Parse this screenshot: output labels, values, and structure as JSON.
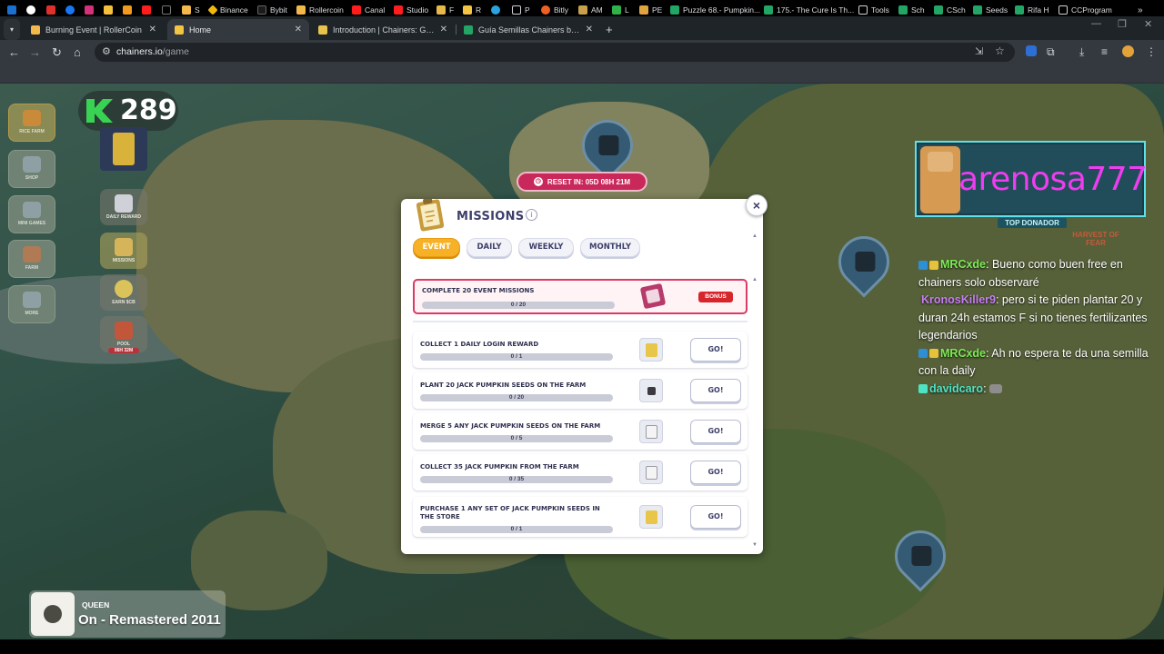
{
  "browser": {
    "tabs": [
      {
        "title": "Burning Event | RollerCoin",
        "active": false
      },
      {
        "title": "Home",
        "active": true
      },
      {
        "title": "Introduction | Chainers: GitBook",
        "active": false
      },
      {
        "title": "Guía Semillas Chainers by Pierc",
        "active": false
      }
    ],
    "new_tab": "+",
    "url_host": "chainers.io",
    "url_path": "/game",
    "bookmarks": [
      "S",
      "Binance",
      "Bybit",
      "Rollercoin",
      "Canal",
      "Studio",
      "F",
      "R",
      "P",
      "Bitly",
      "AM",
      "L",
      "PE",
      "Puzzle 68.- Pumpkin...",
      "175.- The Cure Is Th...",
      "Tools",
      "Sch",
      "CSch",
      "Seeds",
      "Rifa H",
      "CCProgram"
    ]
  },
  "game": {
    "currency_count": "289",
    "reset_timer": "RESET IN: 05D 08H 21M",
    "sidebar": [
      "SHOP",
      "MINI GAMES",
      "FARM",
      "MORE"
    ],
    "side_items": [
      "DAILY REWARD",
      "MISSIONS",
      "EARN $CB",
      "POOL"
    ],
    "side_top_label": "RICE FARM",
    "pool_timer": "06H 32M",
    "map_label": "HARVEST OF FEAR"
  },
  "missions": {
    "title": "MISSIONS",
    "info_icon": "i",
    "close_icon": "×",
    "tabs": [
      "EVENT",
      "DAILY",
      "WEEKLY",
      "MONTHLY"
    ],
    "active_tab": "EVENT",
    "bonus": {
      "label": "COMPLETE 20 EVENT MISSIONS",
      "progress_text": "0 / 20",
      "progress": 0,
      "tag": "BONUS"
    },
    "items": [
      {
        "label": "COLLECT 1 DAILY LOGIN REWARD",
        "progress_text": "0 / 1",
        "progress": 0,
        "go": "GO!"
      },
      {
        "label": "PLANT 20 JACK PUMPKIN SEEDS ON THE FARM",
        "progress_text": "0 / 20",
        "progress": 0,
        "go": "GO!"
      },
      {
        "label": "MERGE 5 ANY JACK PUMPKIN SEEDS ON THE FARM",
        "progress_text": "0 / 5",
        "progress": 0,
        "go": "GO!"
      },
      {
        "label": "COLLECT 35 JACK PUMPKIN FROM THE FARM",
        "progress_text": "0 / 35",
        "progress": 0,
        "go": "GO!"
      },
      {
        "label": "PURCHASE 1 ANY SET OF JACK PUMPKIN SEEDS IN THE STORE",
        "progress_text": "0 / 1",
        "progress": 0,
        "go": "GO!"
      }
    ]
  },
  "overlay": {
    "donor_name": "arenosa777",
    "donor_label": "TOP DONADOR",
    "chat": [
      {
        "user": "MRCxde",
        "text": ": Bueno como buen free en chainers solo observaré",
        "color": "green"
      },
      {
        "user": "KronosKiller9",
        "text": ": pero si te piden plantar 20 y duran 24h estamos F si no tienes fertilizantes legendarios",
        "color": "purple"
      },
      {
        "user": "MRCxde",
        "text": ": Ah no espera te da una semilla con la daily",
        "color": "green"
      },
      {
        "user": "davidcaro",
        "text": ":",
        "color": "teal"
      }
    ],
    "now_playing_artist": "QUEEN",
    "now_playing_song": "On - Remastered 2011"
  }
}
